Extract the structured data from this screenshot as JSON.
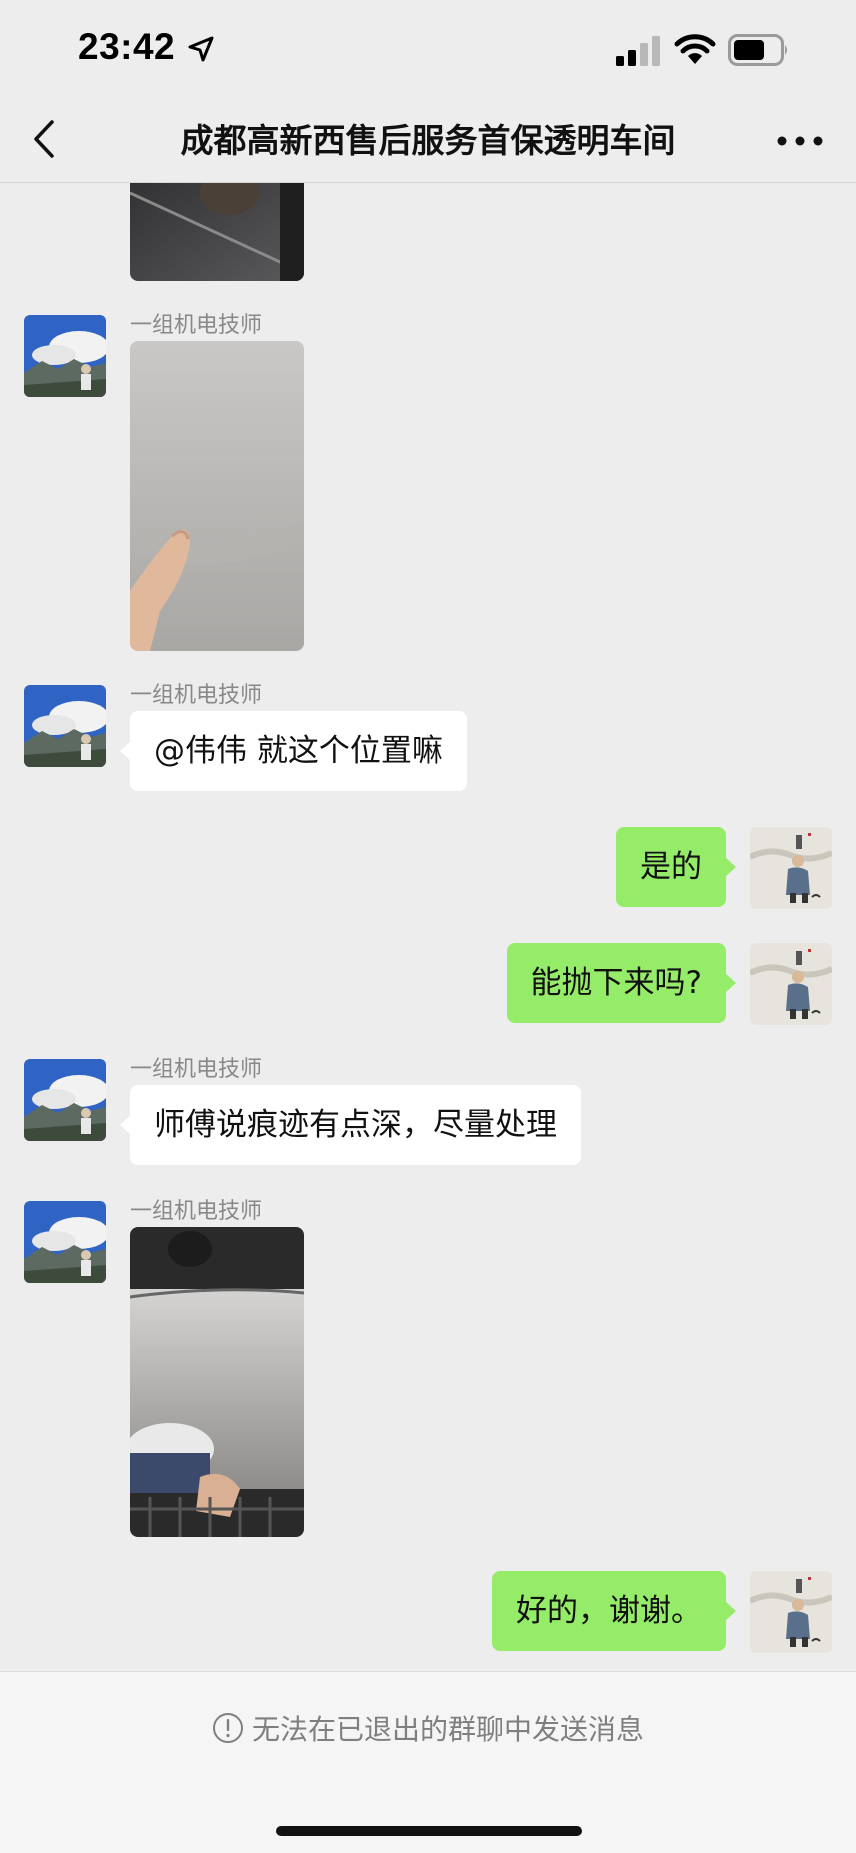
{
  "status_bar": {
    "time": "23:42"
  },
  "nav": {
    "title": "成都高新西售后服务首保透明车间"
  },
  "messages": [
    {
      "type": "image",
      "side": "left"
    },
    {
      "type": "image",
      "side": "left",
      "sender": "一组机电技师"
    },
    {
      "type": "text",
      "side": "left",
      "sender": "一组机电技师",
      "text": "@伟伟 就这个位置嘛"
    },
    {
      "type": "text",
      "side": "right",
      "text": "是的"
    },
    {
      "type": "text",
      "side": "right",
      "text": "能抛下来吗?"
    },
    {
      "type": "text",
      "side": "left",
      "sender": "一组机电技师",
      "text": "师傅说痕迹有点深，尽量处理"
    },
    {
      "type": "image",
      "side": "left",
      "sender": "一组机电技师"
    },
    {
      "type": "text",
      "side": "right",
      "text": "好的，谢谢。"
    }
  ],
  "footer": {
    "notice": "无法在已退出的群聊中发送消息"
  },
  "colors": {
    "background": "#ededed",
    "bubble_self": "#95ec69",
    "bubble_other": "#ffffff"
  },
  "icons": [
    "location-arrow-icon",
    "signal-icon",
    "wifi-icon",
    "battery-icon",
    "back-chevron-icon",
    "more-dots-icon",
    "info-circle-icon"
  ]
}
